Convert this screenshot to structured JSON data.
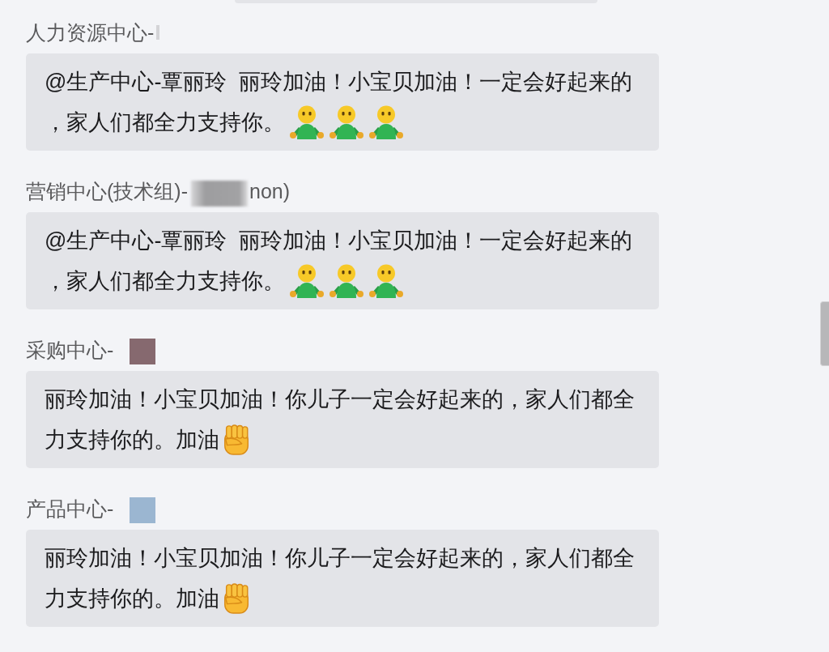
{
  "messages": [
    {
      "sender": {
        "name": "人力资源中心-",
        "redactions": [
          {
            "kind": "trace"
          }
        ]
      },
      "lines": [
        "@生产中心-覃丽玲  丽玲加油！小宝贝加油！一定会好起来的",
        "，家人们都全力支持你。"
      ],
      "emojis": [
        {
          "kind": "person"
        },
        {
          "kind": "person"
        },
        {
          "kind": "person"
        }
      ]
    },
    {
      "sender": {
        "name": "营销中心(技术组)-",
        "redactions": [
          {
            "kind": "blur"
          }
        ],
        "suffix": "non)"
      },
      "lines": [
        "@生产中心-覃丽玲  丽玲加油！小宝贝加油！一定会好起来的",
        "，家人们都全力支持你。"
      ],
      "emojis": [
        {
          "kind": "person"
        },
        {
          "kind": "person"
        },
        {
          "kind": "person"
        }
      ]
    },
    {
      "sender": {
        "name": "采购中心-",
        "redactions": [
          {
            "kind": "block",
            "color": "#86696f"
          }
        ]
      },
      "lines": [
        "丽玲加油！小宝贝加油！你儿子一定会好起来的，家人们都全",
        "力支持你的。加油"
      ],
      "emojis": [
        {
          "kind": "fist"
        }
      ]
    },
    {
      "sender": {
        "name": "产品中心-",
        "redactions": [
          {
            "kind": "block",
            "color": "#9bb6d1"
          }
        ]
      },
      "lines": [
        "丽玲加油！小宝贝加油！你儿子一定会好起来的，家人们都全",
        "力支持你的。加油"
      ],
      "emojis": [
        {
          "kind": "fist"
        }
      ]
    }
  ]
}
